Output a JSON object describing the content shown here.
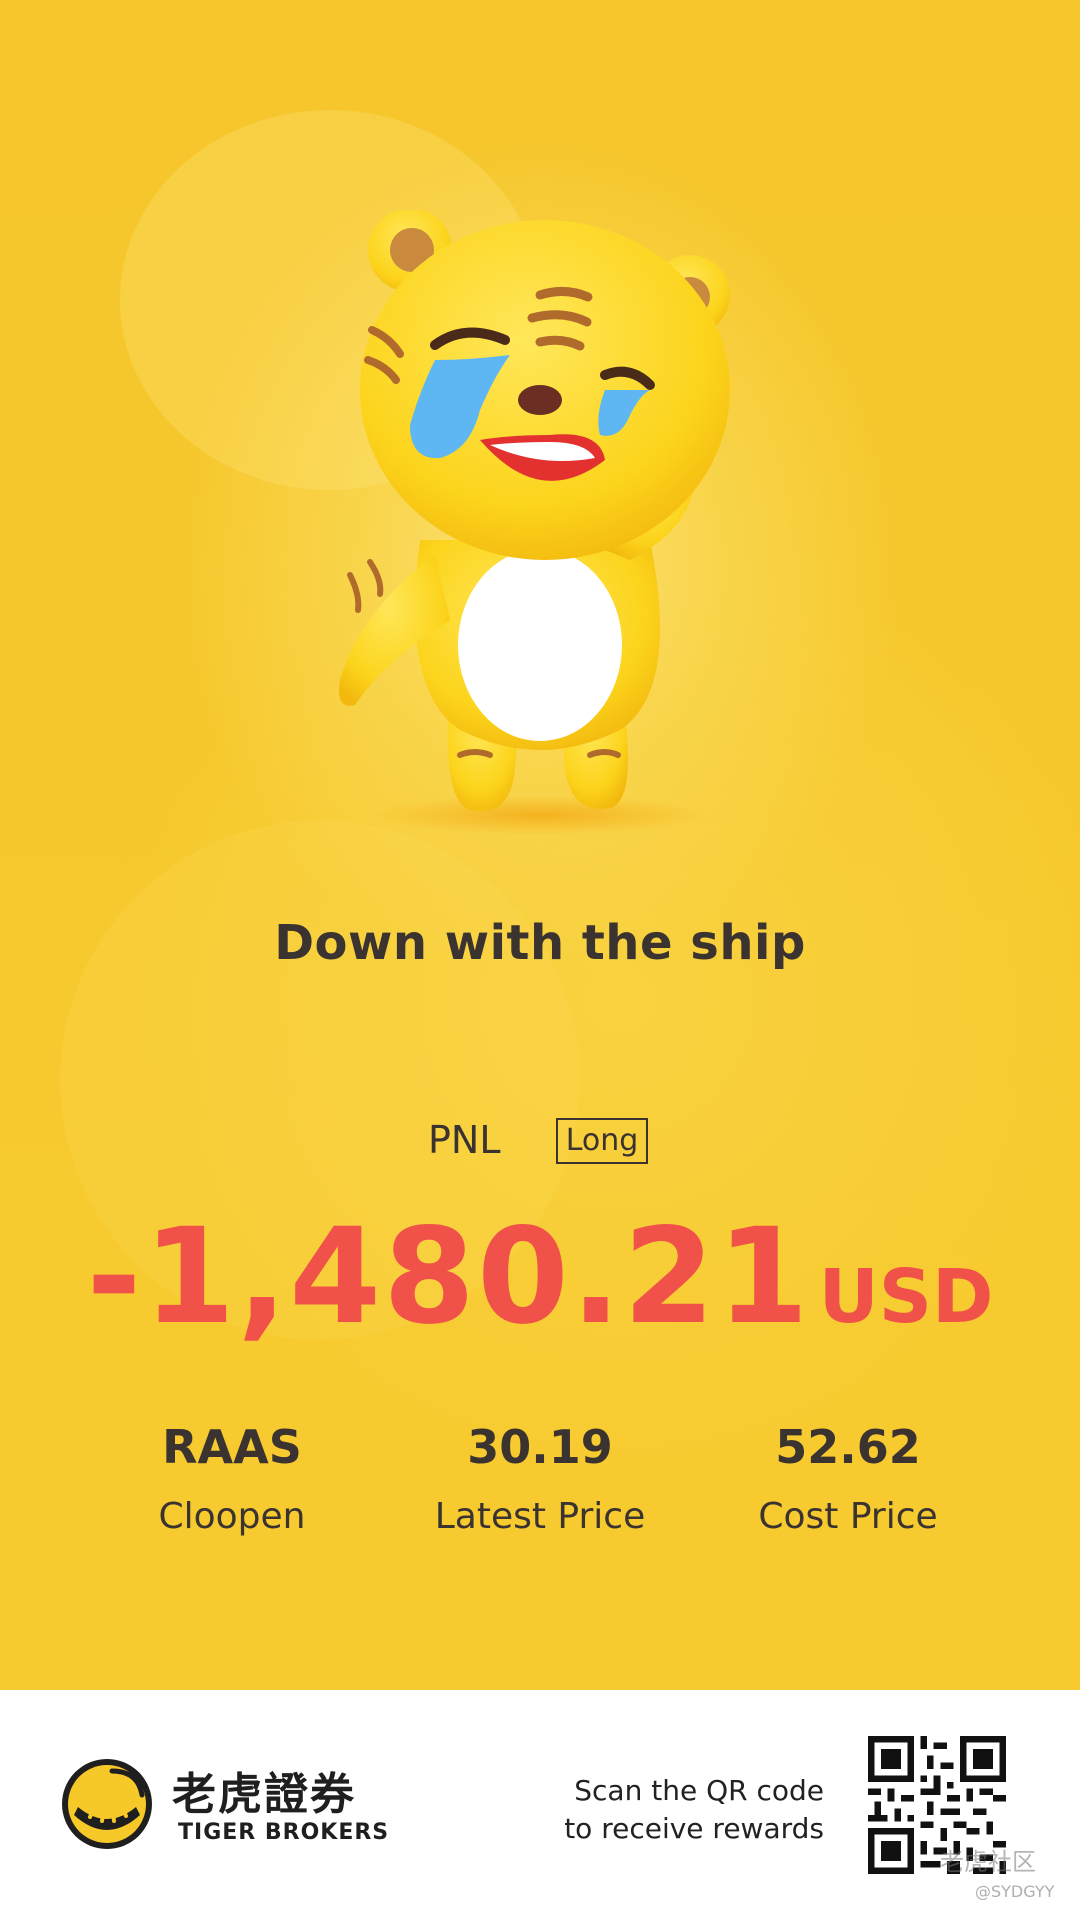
{
  "headline": "Down with the ship",
  "pnl": {
    "label": "PNL",
    "position_type": "Long",
    "amount": "-1,480.21",
    "currency": "USD"
  },
  "stats": [
    {
      "value": "RAAS",
      "label": "Cloopen"
    },
    {
      "value": "30.19",
      "label": "Latest Price"
    },
    {
      "value": "52.62",
      "label": "Cost Price"
    }
  ],
  "footer": {
    "brand_cn": "老虎證券",
    "brand_en": "TIGER BROKERS",
    "scan_line1": "Scan the QR code",
    "scan_line2": "to receive rewards",
    "watermark": "老虎社区",
    "watermark_handle": "@SYDGYY"
  },
  "colors": {
    "background": "#f7c928",
    "loss": "#f0524a",
    "text": "#3a3330"
  },
  "icons": {
    "mascot": "crying-tiger-mascot",
    "logo": "tiger-brokers-logo-icon",
    "qr": "qr-code-icon"
  }
}
